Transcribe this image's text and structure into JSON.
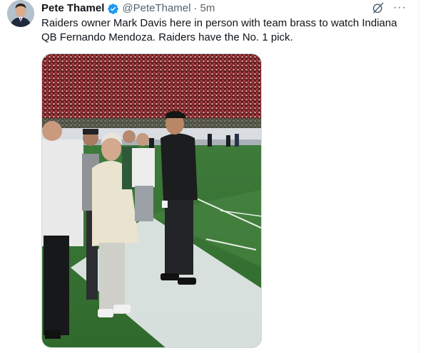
{
  "tweet": {
    "author": {
      "display_name": "Pete Thamel",
      "handle": "@PeteThamel",
      "separator": "·",
      "time": "5m",
      "verified": true
    },
    "text": "Raiders owner Mark Davis here in person with team brass to watch Indiana QB Fernando Mendoza. Raiders have the No. 1 pick.",
    "actions": {
      "grok_icon": "grok-icon",
      "more_icon": "more-icon",
      "more_glyph": "···"
    },
    "media": {
      "type": "photo"
    }
  },
  "colors": {
    "text_primary": "#0f1419",
    "text_secondary": "#536471",
    "verified_blue": "#1d9bf0",
    "border": "#cfd9de"
  }
}
